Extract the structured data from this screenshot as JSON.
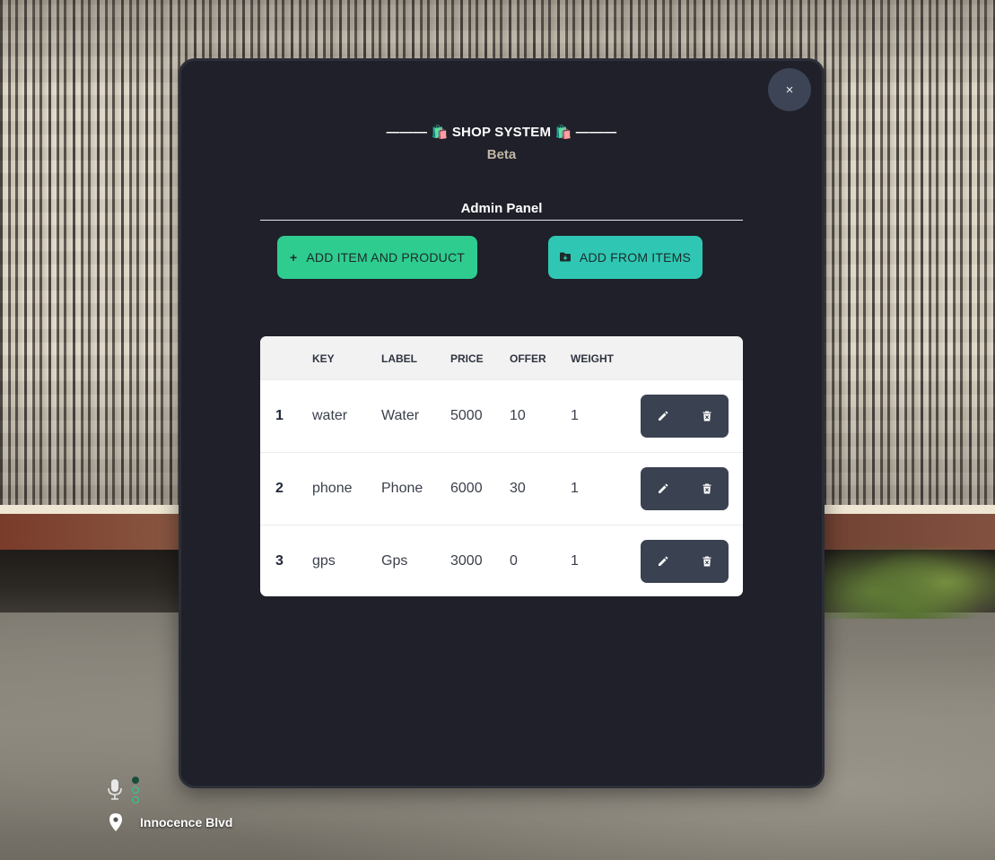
{
  "shop": {
    "title": "——— 🛍️ SHOP SYSTEM 🛍️ ———",
    "subtitle": "Beta",
    "panel_heading": "Admin Panel",
    "close_label": "×"
  },
  "actions": {
    "add_item_icon": "+",
    "add_item_label": "ADD ITEM AND PRODUCT",
    "add_from_icon_name": "folder-icon",
    "add_from_label": "ADD FROM ITEMS"
  },
  "table": {
    "columns": [
      "KEY",
      "LABEL",
      "PRICE",
      "OFFER",
      "WEIGHT"
    ],
    "rows": [
      {
        "num": "1",
        "key": "water",
        "label": "Water",
        "price": "5000",
        "offer": "10",
        "weight": "1"
      },
      {
        "num": "2",
        "key": "phone",
        "label": "Phone",
        "price": "6000",
        "offer": "30",
        "weight": "1"
      },
      {
        "num": "3",
        "key": "gps",
        "label": "Gps",
        "price": "3000",
        "offer": "0",
        "weight": "1"
      }
    ],
    "row_action_icons": [
      "pencil-icon",
      "trash-icon"
    ]
  },
  "hud": {
    "street": "Innocence Blvd",
    "voice_icon": "microphone-icon",
    "location_icon": "map-pin-icon"
  },
  "colors": {
    "modal_bg": "#1f2029",
    "primary_green": "#2ecc8f",
    "teal": "#2fc7b4",
    "action_bg": "#3a4151",
    "subtitle": "#bfb7a6"
  }
}
